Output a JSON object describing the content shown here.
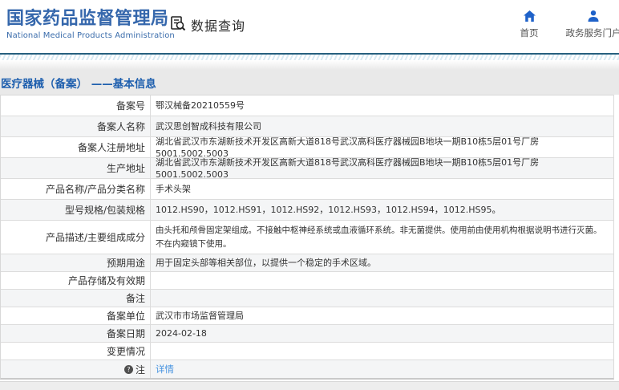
{
  "header": {
    "logo_title": "国家药品监督管理局",
    "logo_subtitle": "National Medical Products Administration",
    "query_label": "数据查询",
    "nav": [
      {
        "icon": "home-icon",
        "label": "首页"
      },
      {
        "icon": "user-icon",
        "label": "政务服务门户"
      }
    ]
  },
  "page": {
    "title": "医疗器械（备案） ——基本信息"
  },
  "table": {
    "rows": [
      {
        "label": "备案号",
        "value": "鄂汉械备20210559号"
      },
      {
        "label": "备案人名称",
        "value": "武汉思创智成科技有限公司"
      },
      {
        "label": "备案人注册地址",
        "value": "湖北省武汉市东湖新技术开发区高新大道818号武汉高科医疗器械园B地块一期B10栋5层01号厂房5001.5002.5003"
      },
      {
        "label": "生产地址",
        "value": "湖北省武汉市东湖新技术开发区高新大道818号武汉高科医疗器械园B地块一期B10栋5层01号厂房5001.5002.5003"
      },
      {
        "label": "产品名称/产品分类名称",
        "value": "手术头架"
      },
      {
        "label": "型号规格/包装规格",
        "value": "1012.HS90，1012.HS91，1012.HS92，1012.HS93，1012.HS94，1012.HS95。"
      },
      {
        "label": "产品描述/主要组成成分",
        "value": "由头托和颅骨固定架组成。不接触中枢神经系统或血液循环系统。非无菌提供。使用前由使用机构根据说明书进行灭菌。不在内窥镜下使用。"
      },
      {
        "label": "预期用途",
        "value": "用于固定头部等相关部位，以提供一个稳定的手术区域。"
      },
      {
        "label": "产品存储及有效期",
        "value": ""
      },
      {
        "label": "备注",
        "value": ""
      },
      {
        "label": "备案单位",
        "value": "武汉市市场监督管理局"
      },
      {
        "label": "备案日期",
        "value": "2024-02-18"
      },
      {
        "label": "变更情况",
        "value": ""
      },
      {
        "label": "注",
        "value": "详情"
      }
    ]
  },
  "colors": {
    "brand_blue": "#3567ac",
    "nav_icon_blue": "#1f62c9",
    "divider_blue": "#27607f",
    "title_blue": "#1e5fae",
    "link_blue": "#4693e0",
    "titlebar_bg": "#e9e9e9",
    "row_alt_bg": "#f4f5f6"
  }
}
